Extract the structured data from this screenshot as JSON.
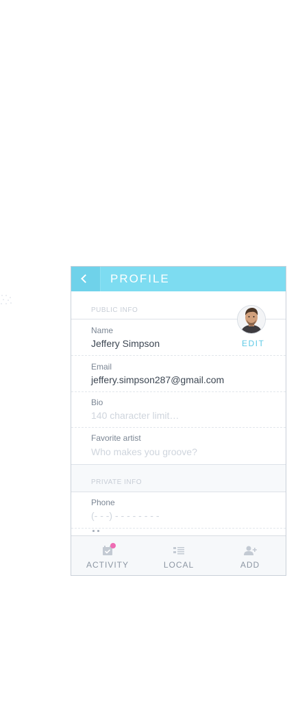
{
  "header": {
    "title": "PROFILE",
    "back_icon": "chevron-left-icon"
  },
  "public_section": {
    "label": "PUBLIC INFO",
    "edit_label": "EDIT",
    "fields": [
      {
        "label": "Name",
        "value": "Jeffery Simpson"
      },
      {
        "label": "Email",
        "value": "jeffery.simpson287@gmail.com"
      },
      {
        "label": "Bio",
        "placeholder": "140 character limit…"
      },
      {
        "label": "Favorite artist",
        "placeholder": "Who makes you groove?"
      }
    ]
  },
  "private_section": {
    "label": "PRIVATE INFO",
    "fields": [
      {
        "label": "Phone",
        "placeholder": "(- - -) - - -  -  - - - -"
      }
    ]
  },
  "tabbar": {
    "items": [
      {
        "label": "ACTIVITY",
        "icon": "calendar-check-icon",
        "has_badge": true
      },
      {
        "label": "LOCAL",
        "icon": "list-icon"
      },
      {
        "label": "ADD",
        "icon": "add-user-icon"
      }
    ]
  },
  "colors": {
    "header": "#7ddcf1",
    "accent": "#5cc9e6",
    "badge": "#ee6cb3",
    "text_dark": "#3c4652",
    "text_muted": "#7a8593"
  }
}
